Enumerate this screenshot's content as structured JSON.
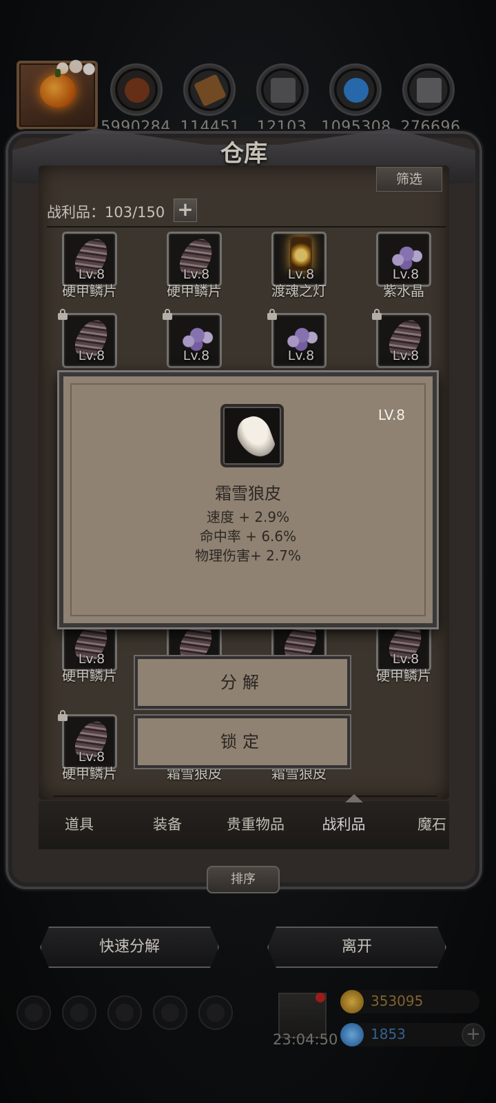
{
  "resources": [
    {
      "value": "5990284",
      "color": "#7a3a1c"
    },
    {
      "value": "114451",
      "color": "#8a5a2a"
    },
    {
      "value": "12103",
      "color": "#5c5c5e"
    },
    {
      "value": "1095308",
      "color": "#2f7fd0"
    },
    {
      "value": "276696",
      "color": "#6a6a6c"
    }
  ],
  "warehouse": {
    "title": "仓库",
    "filter_label": "筛选",
    "count_label": "战利品：103/150",
    "add_label": "+"
  },
  "items": [
    {
      "lv": "Lv.8",
      "name": "硬甲鳞片",
      "type": "scale",
      "locked": false
    },
    {
      "lv": "Lv.8",
      "name": "硬甲鳞片",
      "type": "scale",
      "locked": false
    },
    {
      "lv": "Lv.8",
      "name": "渡魂之灯",
      "type": "lantern",
      "locked": false
    },
    {
      "lv": "Lv.8",
      "name": "紫水晶",
      "type": "crystal",
      "locked": false
    },
    {
      "lv": "Lv.8",
      "name": "",
      "type": "scale",
      "locked": true
    },
    {
      "lv": "Lv.8",
      "name": "",
      "type": "crystal",
      "locked": true
    },
    {
      "lv": "Lv.8",
      "name": "",
      "type": "crystal",
      "locked": true
    },
    {
      "lv": "Lv.8",
      "name": "",
      "type": "scale",
      "locked": true
    },
    {
      "lv": "Lv.8",
      "name": "硬甲鳞片",
      "type": "scale",
      "locked": false
    },
    {
      "lv": "",
      "name": "",
      "type": "scale",
      "locked": false
    },
    {
      "lv": "",
      "name": "",
      "type": "scale",
      "locked": false
    },
    {
      "lv": "Lv.8",
      "name": "硬甲鳞片",
      "type": "scale",
      "locked": false
    },
    {
      "lv": "Lv.8",
      "name": "硬甲鳞片",
      "type": "scale",
      "locked": true
    },
    {
      "lv": "",
      "name": "霜雪狼皮",
      "type": "none",
      "locked": false
    },
    {
      "lv": "",
      "name": "霜雪狼皮",
      "type": "none",
      "locked": false
    }
  ],
  "tabs": [
    "道具",
    "装备",
    "贵重物品",
    "战利品",
    "魔石"
  ],
  "active_tab": "战利品",
  "sort_label": "排序",
  "quick_decompose_label": "快速分解",
  "leave_label": "离开",
  "popup": {
    "lv": "LV.8",
    "name": "霜雪狼皮",
    "stats": [
      "速度 + 2.9%",
      "命中率 + 6.6%",
      "物理伤害+ 2.7%"
    ],
    "decompose_label": "分解",
    "lock_label": "锁定"
  },
  "hud": {
    "timer": "23:04:50",
    "gold": "353095",
    "gems": "1853",
    "gold_color": "#c89a2a",
    "gem_color": "#2f86d8"
  }
}
